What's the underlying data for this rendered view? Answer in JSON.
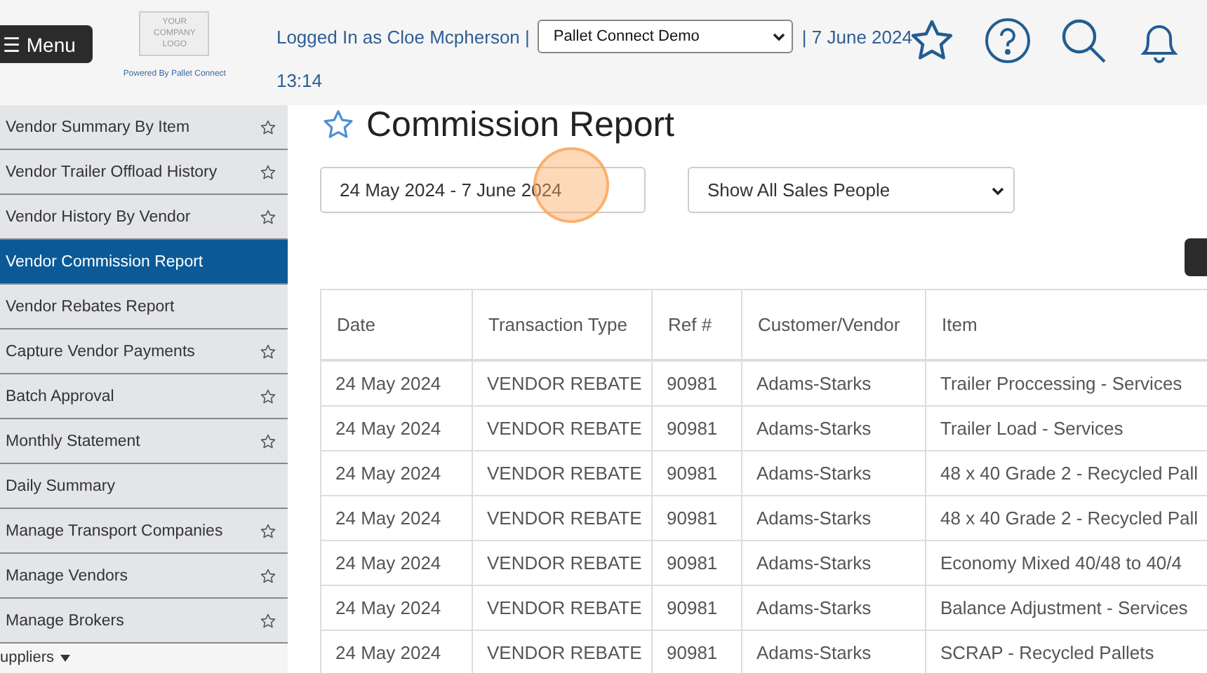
{
  "header": {
    "menu_button": "☰ Menu",
    "logo_lines": [
      "YOUR",
      "COMPANY",
      "LOGO"
    ],
    "powered_by": "Powered By Pallet Connect",
    "logged_in": "Logged In as Cloe Mcpherson |",
    "company_select": "Pallet Connect Demo",
    "date": "| 7 June 2024",
    "time": "13:14"
  },
  "sidebar": {
    "items": [
      {
        "label": "Vendor Summary By Item",
        "selected": false,
        "favorite": true
      },
      {
        "label": "Vendor Trailer Offload History",
        "selected": false,
        "favorite": true
      },
      {
        "label": "Vendor History By Vendor",
        "selected": false,
        "favorite": true
      },
      {
        "label": "Vendor Commission Report",
        "selected": true,
        "favorite": false
      },
      {
        "label": "Vendor Rebates Report",
        "selected": false,
        "favorite": false
      },
      {
        "label": "Capture Vendor Payments",
        "selected": false,
        "favorite": true
      },
      {
        "label": "Batch Approval",
        "selected": false,
        "favorite": true
      },
      {
        "label": "Monthly Statement",
        "selected": false,
        "favorite": true
      },
      {
        "label": "Daily Summary",
        "selected": false,
        "favorite": false
      },
      {
        "label": "Manage Transport Companies",
        "selected": false,
        "favorite": true
      },
      {
        "label": "Manage Vendors",
        "selected": false,
        "favorite": true
      },
      {
        "label": "Manage Brokers",
        "selected": false,
        "favorite": true
      }
    ],
    "section": "uppliers"
  },
  "page": {
    "title": "Commission Report",
    "date_range": "24 May 2024 - 7 June 2024",
    "sales_people": "Show All Sales People"
  },
  "table": {
    "columns": [
      "Date",
      "Transaction Type",
      "Ref #",
      "Customer/Vendor",
      "Item"
    ],
    "rows": [
      [
        "24 May 2024",
        "VENDOR REBATE",
        "90981",
        "Adams-Starks",
        "Trailer Proccessing - Services"
      ],
      [
        "24 May 2024",
        "VENDOR REBATE",
        "90981",
        "Adams-Starks",
        "Trailer Load - Services"
      ],
      [
        "24 May 2024",
        "VENDOR REBATE",
        "90981",
        "Adams-Starks",
        "48 x 40 Grade 2 - Recycled Pall"
      ],
      [
        "24 May 2024",
        "VENDOR REBATE",
        "90981",
        "Adams-Starks",
        "48 x 40 Grade 2 - Recycled Pall"
      ],
      [
        "24 May 2024",
        "VENDOR REBATE",
        "90981",
        "Adams-Starks",
        "Economy Mixed 40/48 to 40/4"
      ],
      [
        "24 May 2024",
        "VENDOR REBATE",
        "90981",
        "Adams-Starks",
        "Balance Adjustment - Services"
      ],
      [
        "24 May 2024",
        "VENDOR REBATE",
        "90981",
        "Adams-Starks",
        "SCRAP - Recycled Pallets"
      ]
    ]
  }
}
